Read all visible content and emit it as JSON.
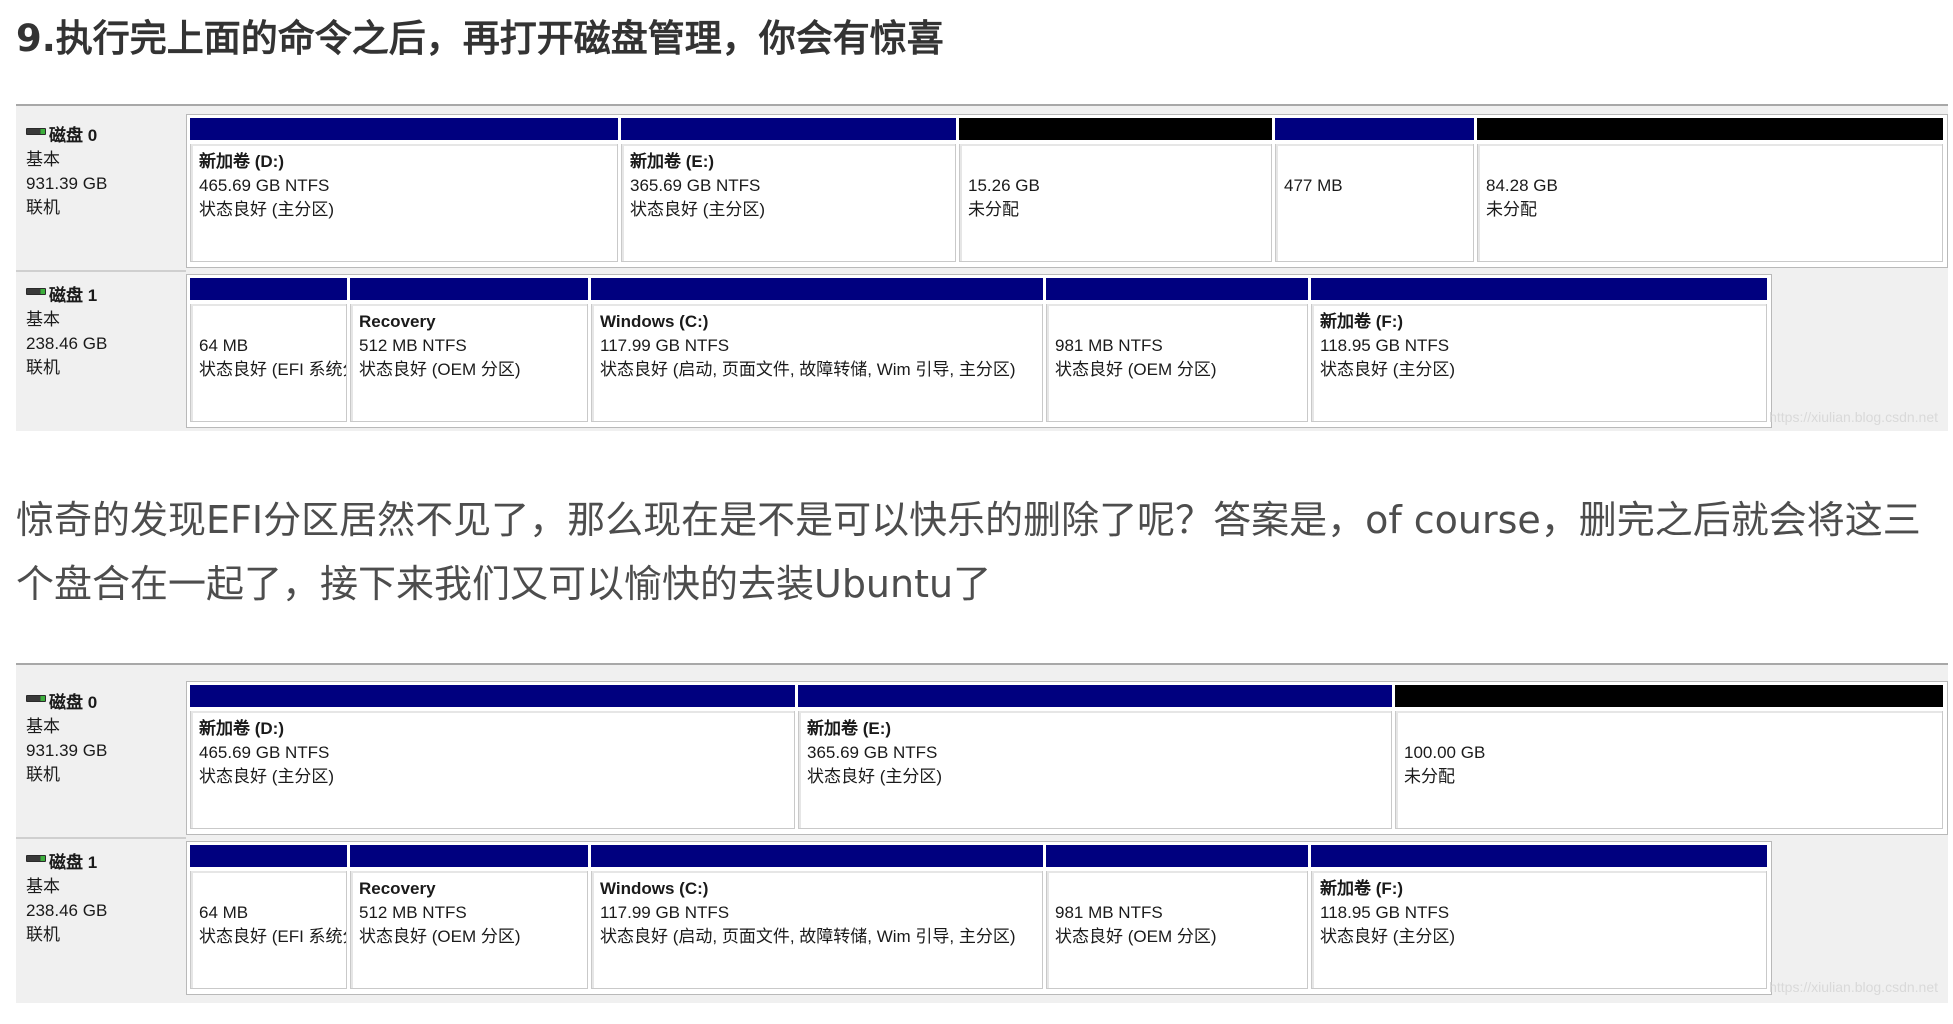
{
  "heading": "9.执行完上面的命令之后，再打开磁盘管理，你会有惊喜",
  "paragraph": "惊奇的发现EFI分区居然不见了，那么现在是不是可以快乐的删除了呢？答案是，of course，删完之后就会将这三个盘合在一起了，接下来我们又可以愉快的去装Ubuntu了",
  "colors": {
    "primary_bar": "#00007f",
    "unallocated_bar": "#000000"
  },
  "watermark": "https://xiulian.blog.csdn.net",
  "panels": [
    {
      "disks": [
        {
          "name": "磁盘 0",
          "type": "基本",
          "size": "931.39 GB",
          "status": "联机",
          "partitions": [
            {
              "name": "新加卷 (D:)",
              "size": "465.69 GB NTFS",
              "status": "状态良好 (主分区)",
              "bar": "primary"
            },
            {
              "name": "新加卷 (E:)",
              "size": "365.69 GB NTFS",
              "status": "状态良好 (主分区)",
              "bar": "primary"
            },
            {
              "name": "",
              "size": "15.26 GB",
              "status": "未分配",
              "bar": "unallocated"
            },
            {
              "name": "",
              "size": "477 MB",
              "status": "",
              "bar": "primary"
            },
            {
              "name": "",
              "size": "84.28 GB",
              "status": "未分配",
              "bar": "unallocated"
            }
          ]
        },
        {
          "name": "磁盘 1",
          "type": "基本",
          "size": "238.46 GB",
          "status": "联机",
          "partitions": [
            {
              "name": "",
              "size": "64 MB",
              "status": "状态良好 (EFI 系统分区)",
              "bar": "primary"
            },
            {
              "name": "Recovery",
              "size": "512 MB NTFS",
              "status": "状态良好 (OEM 分区)",
              "bar": "primary"
            },
            {
              "name": "Windows  (C:)",
              "size": "117.99 GB NTFS",
              "status": "状态良好 (启动, 页面文件, 故障转储, Wim 引导, 主分区)",
              "bar": "primary"
            },
            {
              "name": "",
              "size": "981 MB NTFS",
              "status": "状态良好 (OEM 分区)",
              "bar": "primary"
            },
            {
              "name": "新加卷  (F:)",
              "size": "118.95 GB NTFS",
              "status": "状态良好 (主分区)",
              "bar": "primary"
            }
          ]
        }
      ]
    },
    {
      "disks": [
        {
          "name": "磁盘 0",
          "type": "基本",
          "size": "931.39 GB",
          "status": "联机",
          "partitions": [
            {
              "name": "新加卷 (D:)",
              "size": "465.69 GB NTFS",
              "status": "状态良好 (主分区)",
              "bar": "primary"
            },
            {
              "name": "新加卷 (E:)",
              "size": "365.69 GB NTFS",
              "status": "状态良好 (主分区)",
              "bar": "primary"
            },
            {
              "name": "",
              "size": "100.00 GB",
              "status": "未分配",
              "bar": "unallocated"
            }
          ]
        },
        {
          "name": "磁盘 1",
          "type": "基本",
          "size": "238.46 GB",
          "status": "联机",
          "partitions": [
            {
              "name": "",
              "size": "64 MB",
              "status": "状态良好 (EFI 系统分区)",
              "bar": "primary"
            },
            {
              "name": "Recovery",
              "size": "512 MB NTFS",
              "status": "状态良好 (OEM 分区)",
              "bar": "primary"
            },
            {
              "name": "Windows  (C:)",
              "size": "117.99 GB NTFS",
              "status": "状态良好 (启动, 页面文件, 故障转储, Wim 引导, 主分区)",
              "bar": "primary"
            },
            {
              "name": "",
              "size": "981 MB NTFS",
              "status": "状态良好 (OEM 分区)",
              "bar": "primary"
            },
            {
              "name": "新加卷  (F:)",
              "size": "118.95 GB NTFS",
              "status": "状态良好 (主分区)",
              "bar": "primary"
            }
          ]
        }
      ]
    }
  ]
}
